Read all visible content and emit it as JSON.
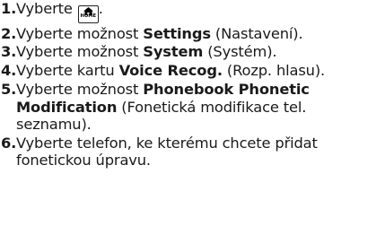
{
  "steps": [
    {
      "num": "1.",
      "pre": "Vyberte",
      "icon": {
        "name": "home-icon",
        "text": "HOME"
      },
      "post": "."
    },
    {
      "num": "2.",
      "pre": "Vyberte možnost ",
      "bold": "Settings",
      "post": " (Nastavení)."
    },
    {
      "num": "3.",
      "pre": "Vyberte možnost ",
      "bold": "System",
      "post": " (Systém)."
    },
    {
      "num": "4.",
      "pre": "Vyberte kartu ",
      "bold": "Voice Recog.",
      "post": " (Rozp. hlasu)."
    },
    {
      "num": "5.",
      "pre": "Vyberte možnost ",
      "bold": "Phonebook Phonetic Modification",
      "post": " (Fonetická modifikace tel. seznamu)."
    },
    {
      "num": "6.",
      "text": "Vyberte telefon, ke kterému chcete přidat fonetickou úpravu."
    }
  ]
}
